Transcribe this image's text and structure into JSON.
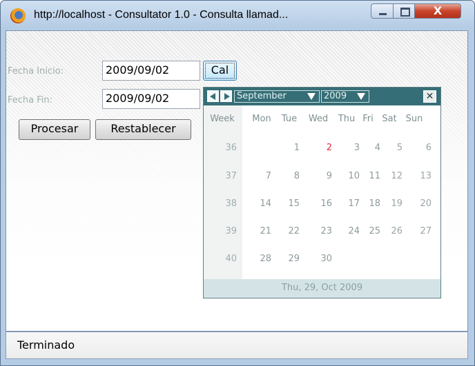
{
  "window": {
    "title": "http://localhost - Consultator 1.0 - Consulta llamad...",
    "close_glyph": "X",
    "icon": "firefox-icon"
  },
  "form": {
    "start_label": "Fecha Inicio:",
    "start_value": "2009/09/02",
    "end_label": "Fecha Fin:",
    "end_value": "2009/09/02",
    "cal_button": "Cal",
    "process_button": "Procesar",
    "reset_button": "Restablecer"
  },
  "calendar": {
    "month": "September",
    "year": "2009",
    "close_glyph": "✕",
    "footer": "Thu, 29, Oct 2009",
    "day_headers": [
      "Week",
      "Mon",
      "Tue",
      "Wed",
      "Thu",
      "Fri",
      "Sat",
      "Sun"
    ],
    "weeks": [
      {
        "week": "36",
        "days": [
          "",
          "1",
          "2",
          "3",
          "4",
          "5",
          "6"
        ]
      },
      {
        "week": "37",
        "days": [
          "7",
          "8",
          "9",
          "10",
          "11",
          "12",
          "13"
        ]
      },
      {
        "week": "38",
        "days": [
          "14",
          "15",
          "16",
          "17",
          "18",
          "19",
          "20"
        ]
      },
      {
        "week": "39",
        "days": [
          "21",
          "22",
          "23",
          "24",
          "25",
          "26",
          "27"
        ]
      },
      {
        "week": "40",
        "days": [
          "28",
          "29",
          "30",
          "",
          "",
          "",
          ""
        ]
      }
    ],
    "highlighted_day": "2",
    "highlight_color": "#e0303a",
    "header_color": "#356e76"
  },
  "status_bar": {
    "text": "Terminado"
  }
}
